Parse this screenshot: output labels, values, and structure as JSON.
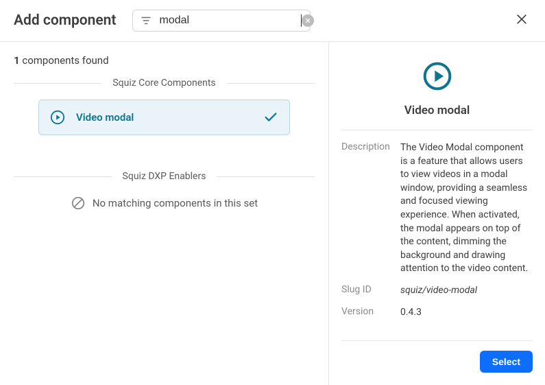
{
  "header": {
    "title": "Add component",
    "search": {
      "placeholder": "modal",
      "value": "modal"
    }
  },
  "found": {
    "count": "1",
    "suffix": "components found"
  },
  "sections": {
    "core": {
      "label": "Squiz Core Components",
      "items": [
        {
          "name": "Video modal",
          "selected": true
        }
      ]
    },
    "dxp": {
      "label": "Squiz DXP Enablers",
      "empty_text": "No matching components in this set"
    }
  },
  "detail": {
    "title": "Video modal",
    "labels": {
      "description": "Description",
      "slug": "Slug ID",
      "version": "Version"
    },
    "description": "The Video Modal component is a feature that allows users to view videos in a modal window, providing a seamless and focused viewing experience. When activated, the modal appears on top of the content, dimming the background and drawing attention to the video content.",
    "slug": "squiz/video-modal",
    "version": "0.4.3"
  },
  "buttons": {
    "select": "Select"
  },
  "colors": {
    "accent": "#0e7490",
    "primary_button": "#0d6efd",
    "selected_bg": "#e9f3f8"
  }
}
